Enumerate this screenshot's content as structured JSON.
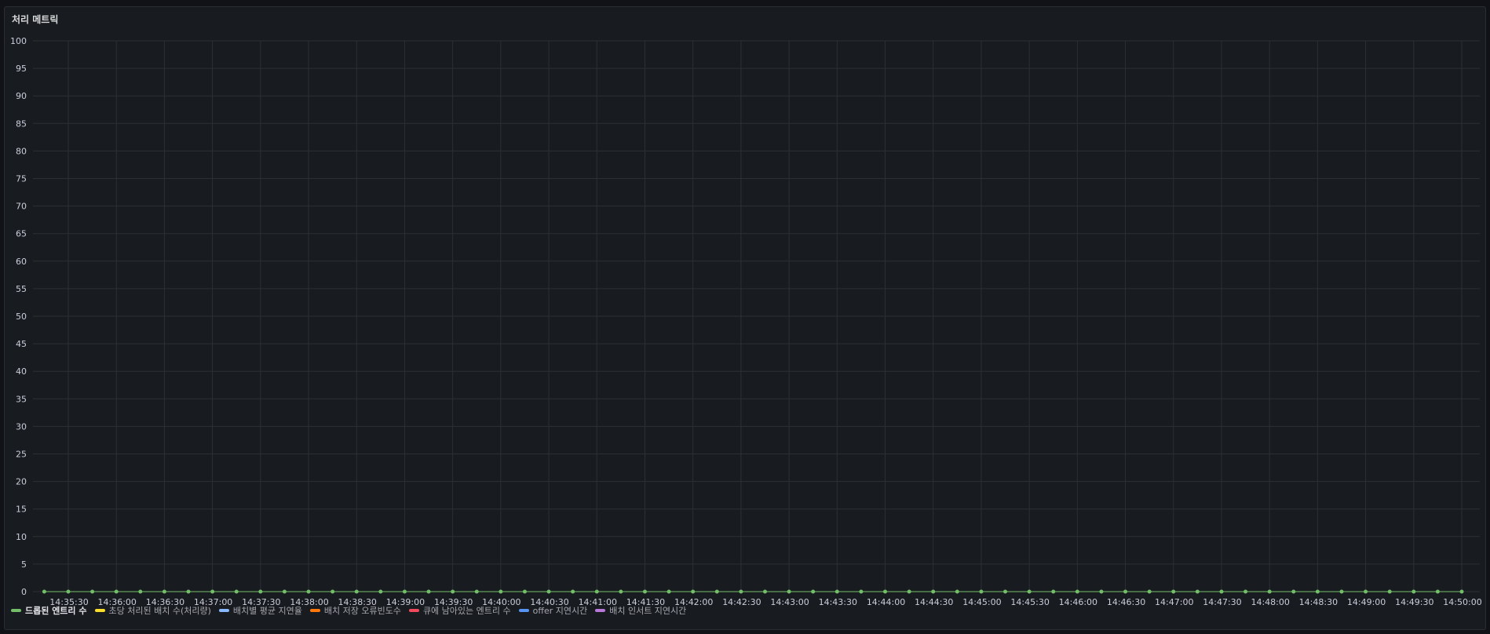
{
  "panel": {
    "title": "처리 메트릭"
  },
  "chart_data": {
    "type": "line",
    "ylim": [
      0,
      100
    ],
    "y_ticks": [
      0,
      5,
      10,
      15,
      20,
      25,
      30,
      35,
      40,
      45,
      50,
      55,
      60,
      65,
      70,
      75,
      80,
      85,
      90,
      95,
      100
    ],
    "x_tick_labels": [
      "14:35:30",
      "14:36:00",
      "14:36:30",
      "14:37:00",
      "14:37:30",
      "14:38:00",
      "14:38:30",
      "14:39:00",
      "14:39:30",
      "14:40:00",
      "14:40:30",
      "14:41:00",
      "14:41:30",
      "14:42:00",
      "14:42:30",
      "14:43:00",
      "14:43:30",
      "14:44:00",
      "14:44:30",
      "14:45:00",
      "14:45:30",
      "14:46:00",
      "14:46:30",
      "14:47:00",
      "14:47:30",
      "14:48:00",
      "14:48:30",
      "14:49:00",
      "14:49:30",
      "14:50:00"
    ],
    "grid": true,
    "legend_position": "bottom-left",
    "series": [
      {
        "name": "드롭된 엔트리 수",
        "color": "#73bf69",
        "active": true,
        "values": [
          0,
          0,
          0,
          0,
          0,
          0,
          0,
          0,
          0,
          0,
          0,
          0,
          0,
          0,
          0,
          0,
          0,
          0,
          0,
          0,
          0,
          0,
          0,
          0,
          0,
          0,
          0,
          0,
          0,
          0,
          0,
          0,
          0,
          0,
          0,
          0,
          0,
          0,
          0,
          0,
          0,
          0,
          0,
          0,
          0,
          0,
          0,
          0,
          0,
          0,
          0,
          0,
          0,
          0,
          0,
          0,
          0,
          0,
          0,
          0
        ]
      },
      {
        "name": "초당 처리된 배치 수(처리량)",
        "color": "#fade2a",
        "active": false
      },
      {
        "name": "배치별 평균 지연율",
        "color": "#8ab8ff",
        "active": false
      },
      {
        "name": "배치 저장 오류빈도수",
        "color": "#ff780a",
        "active": false
      },
      {
        "name": "큐에 남아있는 엔트리 수",
        "color": "#f2495c",
        "active": false
      },
      {
        "name": "offer 지연시간",
        "color": "#5794f2",
        "active": false
      },
      {
        "name": "배치 인서트 지연시간",
        "color": "#b877d9",
        "active": false
      }
    ]
  }
}
